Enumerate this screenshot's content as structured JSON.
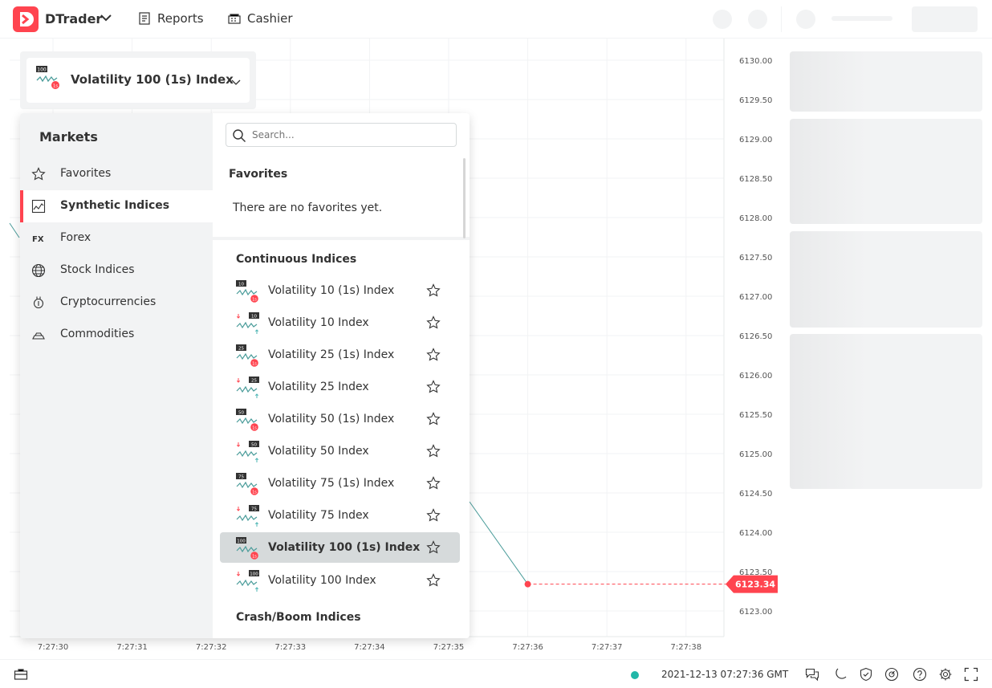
{
  "header": {
    "app_name": "DTrader",
    "nav": [
      {
        "label": "Reports",
        "icon": "reports-icon"
      },
      {
        "label": "Cashier",
        "icon": "cashier-icon"
      }
    ]
  },
  "asset_selector": {
    "selected": "Volatility 100 (1s) Index"
  },
  "markets": {
    "title": "Markets",
    "items": [
      {
        "label": "Favorites",
        "icon": "star-icon"
      },
      {
        "label": "Synthetic Indices",
        "icon": "synthetic-icon",
        "active": true
      },
      {
        "label": "Forex",
        "icon": "forex-icon"
      },
      {
        "label": "Stock Indices",
        "icon": "globe-icon"
      },
      {
        "label": "Cryptocurrencies",
        "icon": "crypto-icon"
      },
      {
        "label": "Commodities",
        "icon": "commodities-icon"
      }
    ]
  },
  "search": {
    "placeholder": "Search..."
  },
  "favorites": {
    "title": "Favorites",
    "empty_text": "There are no favorites yet."
  },
  "continuous": {
    "title": "Continuous Indices",
    "items": [
      {
        "label": "Volatility 10 (1s) Index",
        "badge": "10",
        "one_s": true
      },
      {
        "label": "Volatility 10 Index",
        "badge": "10",
        "one_s": false
      },
      {
        "label": "Volatility 25 (1s) Index",
        "badge": "25",
        "one_s": true
      },
      {
        "label": "Volatility 25 Index",
        "badge": "25",
        "one_s": false
      },
      {
        "label": "Volatility 50 (1s) Index",
        "badge": "50",
        "one_s": true
      },
      {
        "label": "Volatility 50 Index",
        "badge": "50",
        "one_s": false
      },
      {
        "label": "Volatility 75 (1s) Index",
        "badge": "75",
        "one_s": true
      },
      {
        "label": "Volatility 75 Index",
        "badge": "75",
        "one_s": false
      },
      {
        "label": "Volatility 100 (1s) Index",
        "badge": "100",
        "one_s": true,
        "active": true
      },
      {
        "label": "Volatility 100 Index",
        "badge": "100",
        "one_s": false
      }
    ]
  },
  "crash_boom": {
    "title": "Crash/Boom Indices"
  },
  "chart": {
    "y_ticks": [
      "6130.00",
      "6129.50",
      "6129.00",
      "6128.50",
      "6128.00",
      "6127.50",
      "6127.00",
      "6126.50",
      "6126.00",
      "6125.50",
      "6125.00",
      "6124.50",
      "6124.00",
      "6123.50",
      "6123.00"
    ],
    "x_ticks": [
      "7:27:30",
      "7:27:31",
      "7:27:32",
      "7:27:33",
      "7:27:34",
      "7:27:35",
      "7:27:36",
      "7:27:37",
      "7:27:38"
    ],
    "current_price": "6123.34",
    "accent": "#ff444f",
    "line_color": "#4a9c9a"
  },
  "footer": {
    "timestamp": "2021-12-13 07:27:36 GMT",
    "status_color": "#21b7a8"
  }
}
